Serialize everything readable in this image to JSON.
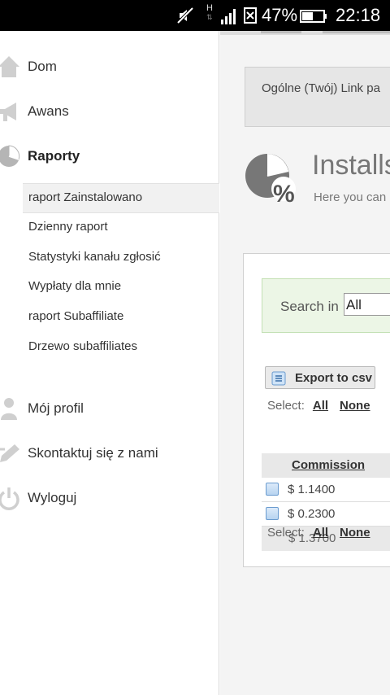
{
  "status_bar": {
    "network_type": "H",
    "battery_percent": "47%",
    "time": "22:18"
  },
  "sidebar": {
    "nav": [
      {
        "label": "Dom",
        "icon": "home-icon"
      },
      {
        "label": "Awans",
        "icon": "megaphone-icon"
      },
      {
        "label": "Raporty",
        "icon": "pie-chart-icon",
        "active": true
      }
    ],
    "reports_submenu": [
      {
        "label": "raport Zainstalowano",
        "active": true
      },
      {
        "label": "Dzienny raport"
      },
      {
        "label": "Statystyki kanału zgłosić"
      },
      {
        "label": "Wypłaty dla mnie"
      },
      {
        "label": "raport Subaffiliate"
      },
      {
        "label": "Drzewo subaffiliates"
      }
    ],
    "nav_bottom": [
      {
        "label": "Mój profil",
        "icon": "user-icon"
      },
      {
        "label": "Skontaktuj się z nami",
        "icon": "pencil-icon"
      },
      {
        "label": "Wyloguj",
        "icon": "power-icon"
      }
    ]
  },
  "main": {
    "link_box_text": "Ogólne (Twój) Link pa",
    "page_title": "Installs",
    "page_subtitle": "Here you can",
    "search": {
      "label": "Search in",
      "selected": "All"
    },
    "export_button": "Export to csv",
    "select_label": "Select:",
    "select_all": "All",
    "select_none": "None",
    "table": {
      "column_header": "Commission",
      "rows": [
        "$ 1.1400",
        "$ 0.2300"
      ],
      "total": "$ 1.3700"
    }
  },
  "colors": {
    "search_bg": "#ecf6e6",
    "checkbox_blue": "#b7d3f0",
    "status_bar": "#000000"
  }
}
